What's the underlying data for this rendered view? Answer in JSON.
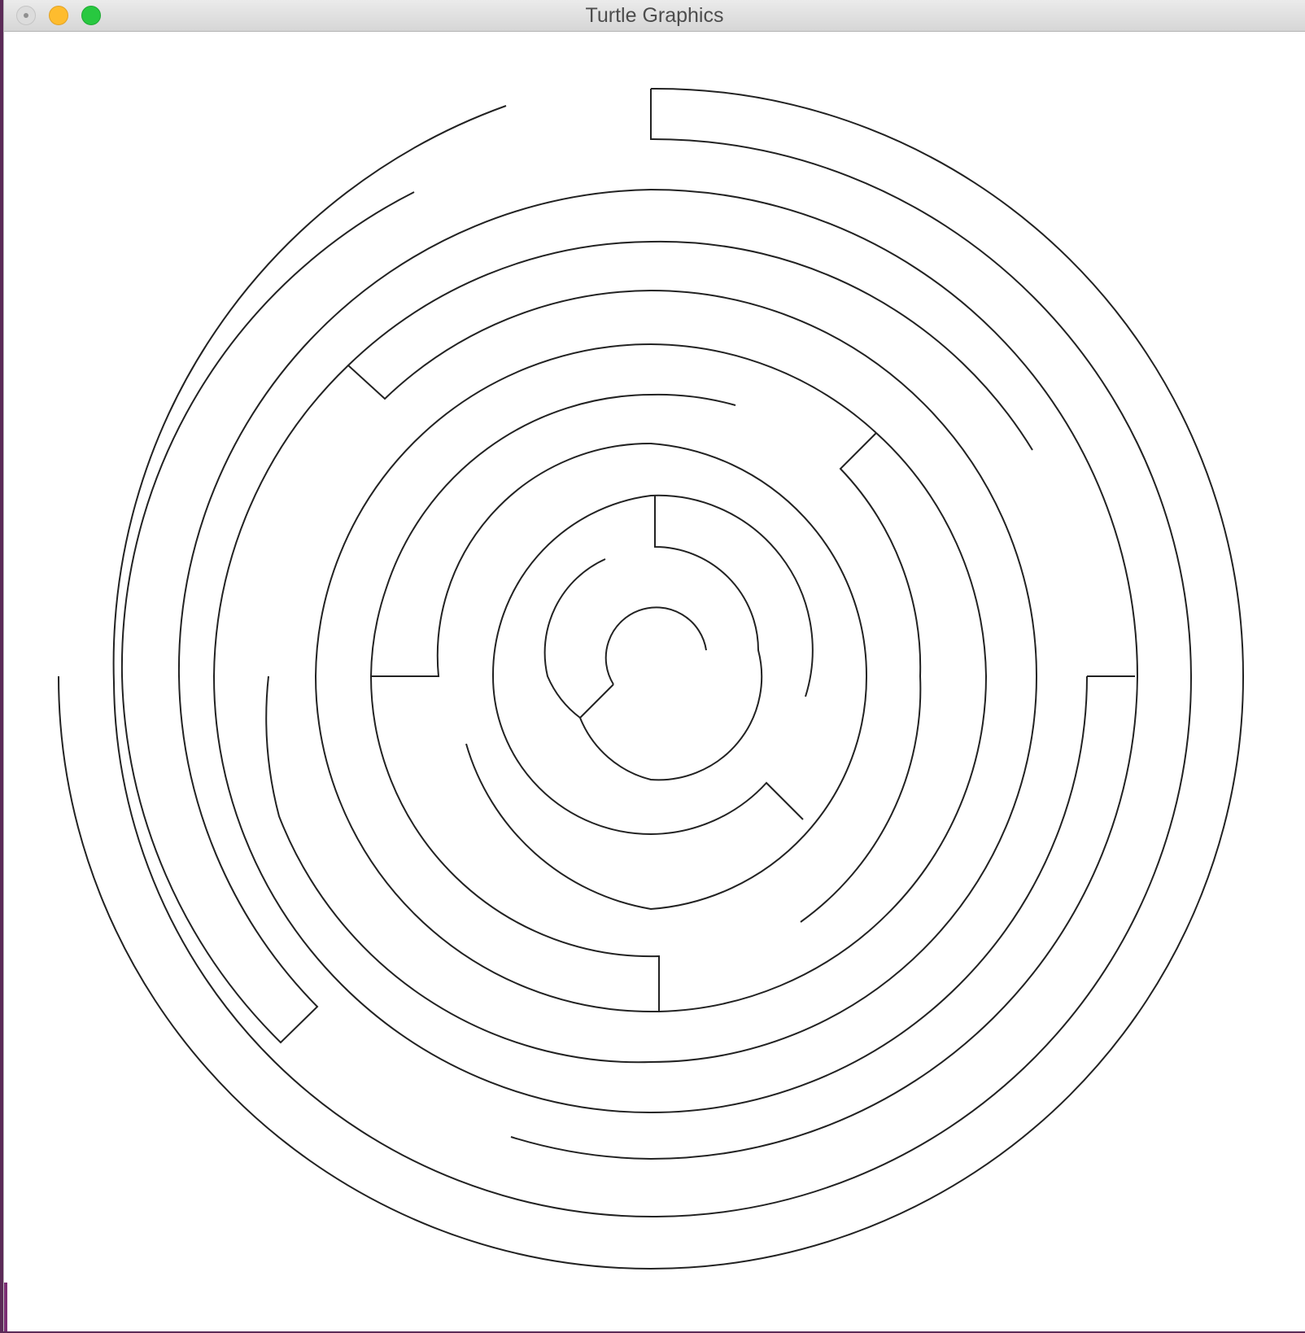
{
  "window": {
    "title": "Turtle Graphics",
    "buttons": {
      "close": "close-window",
      "minimize": "minimize-window",
      "maximize": "zoom-window"
    }
  },
  "canvas": {
    "background": "#ffffff",
    "drawing": "circular-maze",
    "stroke_color": "#222222"
  }
}
